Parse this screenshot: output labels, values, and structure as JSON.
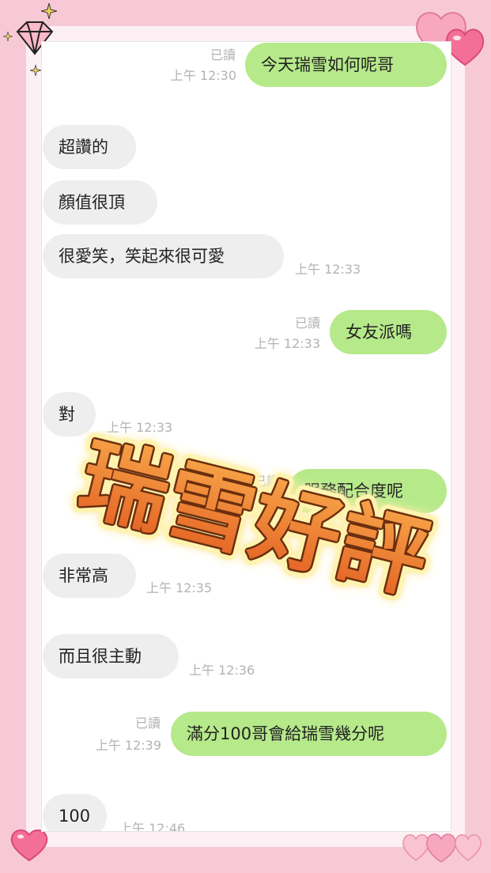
{
  "messages": [
    {
      "dir": "out",
      "text": "今天瑞雪如何呢哥",
      "read": "已讀",
      "time": "上午 12:30"
    },
    {
      "dir": "in",
      "text": "超讚的"
    },
    {
      "dir": "in",
      "text": "顏值很頂"
    },
    {
      "dir": "in",
      "text": "很愛笑，笑起來很可愛",
      "time": "上午 12:33"
    },
    {
      "dir": "out",
      "text": "女友派嗎",
      "read": "已讀",
      "time": "上午 12:33"
    },
    {
      "dir": "in",
      "text": "對",
      "time": "上午 12:33"
    },
    {
      "dir": "out",
      "text": "服務配合度呢",
      "read": "已讀"
    },
    {
      "dir": "in",
      "text": "非常高",
      "time": "上午 12:35"
    },
    {
      "dir": "in",
      "text": "而且很主動",
      "time": "上午 12:36"
    },
    {
      "dir": "out",
      "text": "滿分100哥會給瑞雪幾分呢",
      "read": "已讀",
      "time": "上午 12:39"
    },
    {
      "dir": "in",
      "text": "100",
      "time": "上午 12:46"
    }
  ],
  "overlay": {
    "title": "瑞雪好評"
  },
  "colors": {
    "background": "#f7c9d6",
    "outgoing_bubble": "#b6e98a",
    "incoming_bubble": "#eeeeee",
    "sticker_fill": "#f08a3a",
    "sticker_outline": "#6b2e0e"
  },
  "icons": [
    "diamond-icon",
    "sparkle-icon",
    "heart-icon"
  ]
}
